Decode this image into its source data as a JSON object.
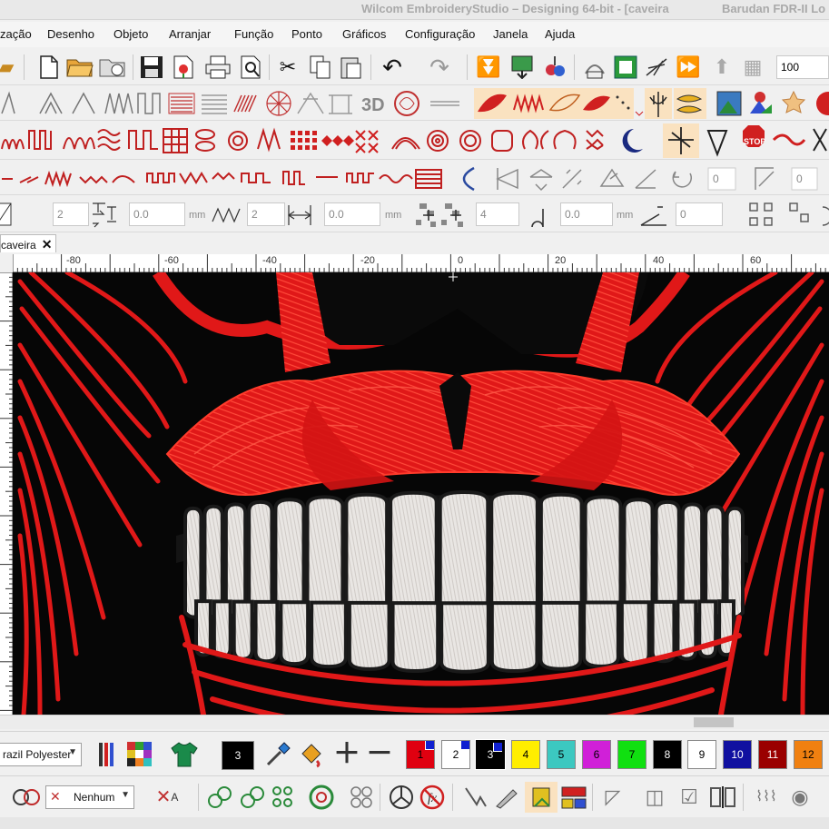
{
  "titlebar": {
    "title": "Wilcom EmbroideryStudio – Designing 64-bit - [caveira",
    "machine": "Barudan FDR-II Lo"
  },
  "menu": [
    {
      "label": "zação"
    },
    {
      "label": "Desenho"
    },
    {
      "label": "Objeto"
    },
    {
      "label": "Arranjar"
    },
    {
      "label": "Função"
    },
    {
      "label": "Ponto"
    },
    {
      "label": "Gráficos"
    },
    {
      "label": "Configuração"
    },
    {
      "label": "Janela"
    },
    {
      "label": "Ajuda"
    }
  ],
  "toolbar_standard": {
    "zoom_value": "100"
  },
  "toolbar_params": {
    "field_1": "2",
    "field_2": "0.0",
    "unit_1": "mm",
    "field_3": "2",
    "field_4": "0.0",
    "unit_2": "mm",
    "field_5": "4",
    "field_6": "0.0",
    "unit_3": "mm",
    "field_7": "0",
    "rotate_value": "0",
    "rotate_value_2": "0"
  },
  "document_tab": {
    "label": "caveira"
  },
  "ruler": {
    "labels": [
      "-80",
      "-60",
      "-40",
      "-20",
      "0",
      "20",
      "40",
      "60"
    ]
  },
  "threads": {
    "chart_name": "razil Polyester",
    "current_color": "3",
    "swatches": [
      {
        "label": "1",
        "color": "#e00010",
        "text_color": "#000000",
        "marked": true
      },
      {
        "label": "2",
        "color": "#ffffff",
        "text_color": "#000000",
        "marked": true
      },
      {
        "label": "3",
        "color": "#000000",
        "text_color": "#ffffff",
        "marked": true,
        "selected": true
      },
      {
        "label": "4",
        "color": "#ffee00",
        "text_color": "#000000"
      },
      {
        "label": "5",
        "color": "#3cc8c0",
        "text_color": "#000000"
      },
      {
        "label": "6",
        "color": "#d020d8",
        "text_color": "#000000"
      },
      {
        "label": "7",
        "color": "#10e010",
        "text_color": "#000000"
      },
      {
        "label": "8",
        "color": "#000000",
        "text_color": "#ffffff"
      },
      {
        "label": "9",
        "color": "#ffffff",
        "text_color": "#000000"
      },
      {
        "label": "10",
        "color": "#1010a0",
        "text_color": "#ffffff"
      },
      {
        "label": "11",
        "color": "#9a0000",
        "text_color": "#ffffff"
      },
      {
        "label": "12",
        "color": "#f08010",
        "text_color": "#000000"
      }
    ]
  },
  "bottom_tools": {
    "effect_combo": "Nenhum"
  }
}
